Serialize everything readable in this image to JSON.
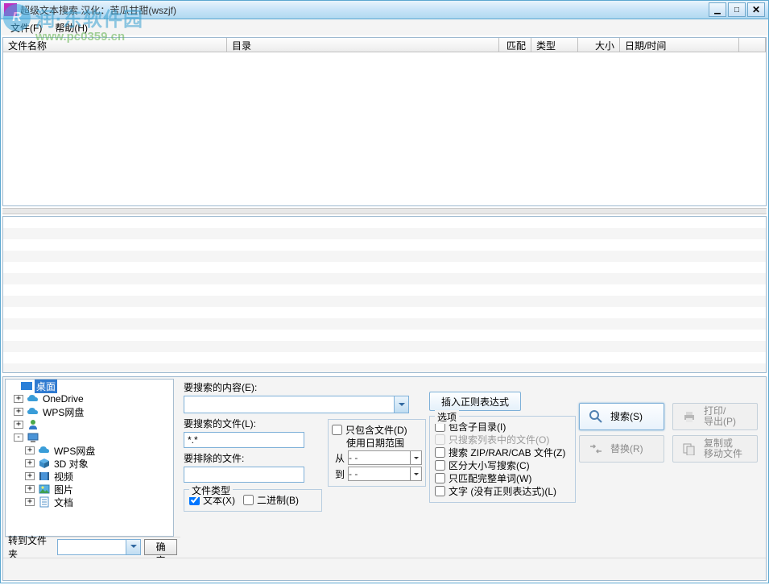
{
  "window": {
    "title": "超级文本搜索        汉化：苦瓜甘甜(wszjf)"
  },
  "menu": {
    "file": "文件(F)",
    "help": "帮助(H)"
  },
  "columns": {
    "filename": "文件名称",
    "directory": "目录",
    "match": "匹配",
    "type": "类型",
    "size": "大小",
    "datetime": "日期/时间"
  },
  "tree": {
    "desktop": "桌面",
    "onedrive": "OneDrive",
    "wps_cloud": "WPS网盘",
    "user": "",
    "this_pc": "",
    "wps_cloud2": "WPS网盘",
    "objects3d": "3D 对象",
    "videos": "视频",
    "pictures": "图片",
    "documents": "文档"
  },
  "goto": {
    "label": "转到文件夹",
    "btn": "确定"
  },
  "form": {
    "content_label": "要搜索的内容(E):",
    "files_label": "要搜索的文件(L):",
    "files_value": "*.*",
    "exclude_label": "要排除的文件:",
    "filetype_legend": "文件类型",
    "filetype_text": "文本(X)",
    "filetype_binary": "二进制(B)",
    "only_include": "只包含文件(D)",
    "use_date": "使用日期范围",
    "from": "从",
    "to": "到",
    "date_placeholder": "-   -",
    "insert_regex": "插入正则表达式",
    "options_legend": "选项",
    "opt_subdirs": "包含子目录(I)",
    "opt_listonly": "只搜索列表中的文件(O)",
    "opt_archives": "搜索 ZIP/RAR/CAB 文件(Z)",
    "opt_case": "区分大小写搜索(C)",
    "opt_whole": "只匹配完整单词(W)",
    "opt_literal": "文字 (没有正则表达式)(L)"
  },
  "buttons": {
    "search": "搜索(S)",
    "replace": "替换(R)",
    "print": "打印/\n导出(P)",
    "copymove": "复制或\n移动文件"
  },
  "watermark": {
    "name": "润·东软件园",
    "url": "www.pc0359.cn"
  }
}
